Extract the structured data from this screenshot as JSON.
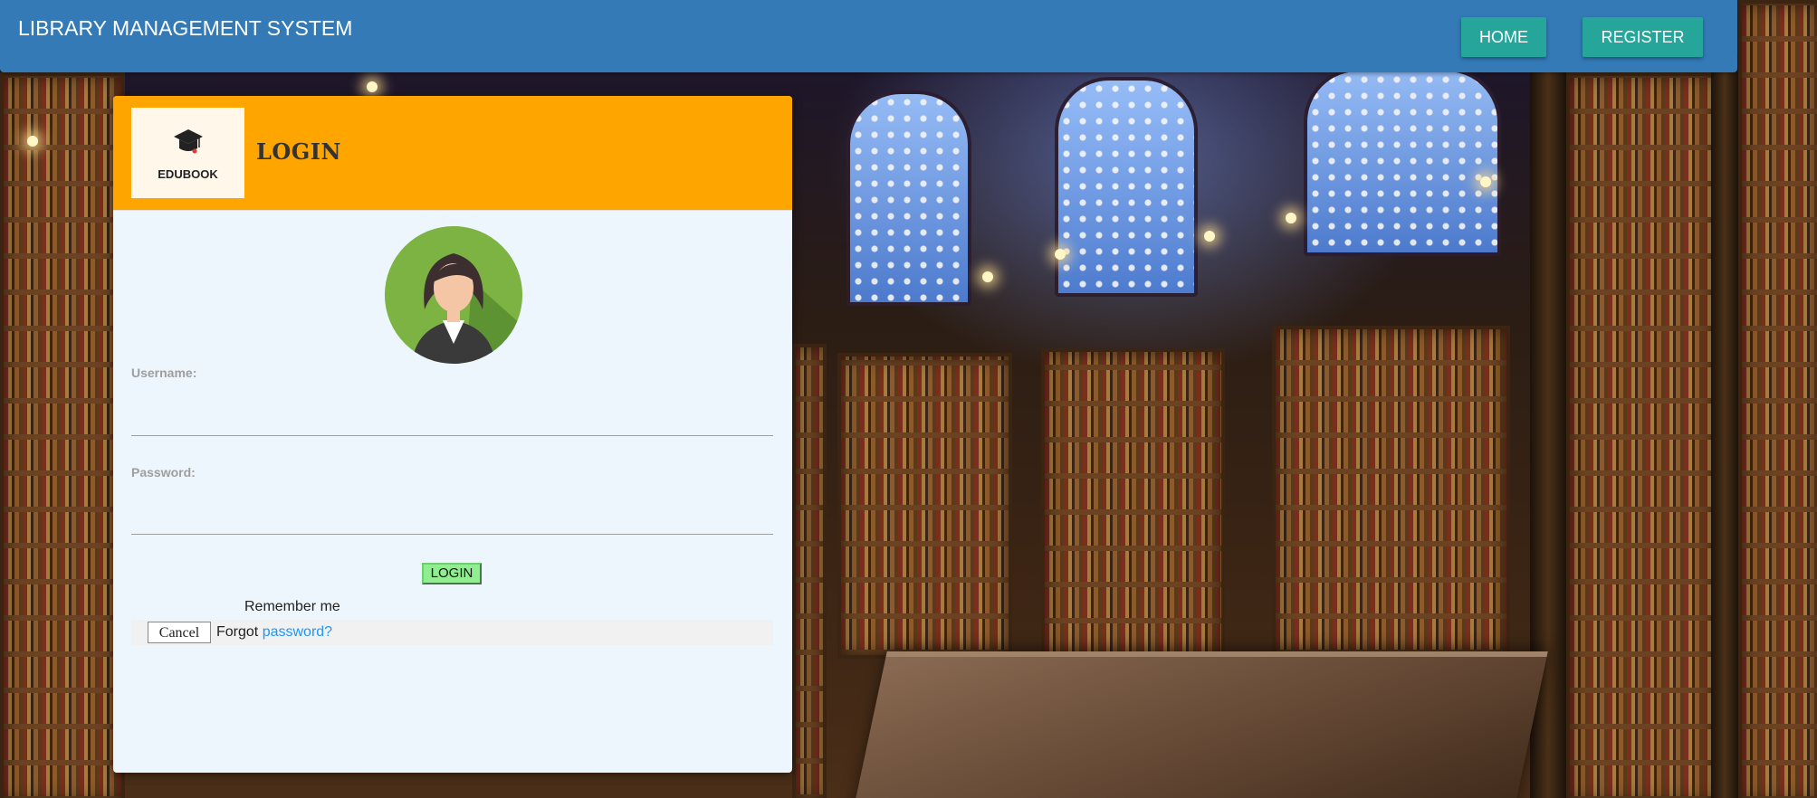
{
  "navbar": {
    "brand": "LIBRARY MANAGEMENT SYSTEM",
    "home_label": "HOME",
    "register_label": "REGISTER",
    "color": "#337ab7",
    "button_color": "#26a69a"
  },
  "login_card": {
    "logo_text": "EDUBOOK",
    "logo_icon": "graduation-cap-icon",
    "title": "LOGIN",
    "header_color": "#ffa500",
    "avatar": "user-avatar-icon",
    "username_label": "Username:",
    "username_value": "",
    "password_label": "Password:",
    "password_value": "",
    "login_button": "LOGIN",
    "remember_label": "Remember me",
    "cancel_button": "Cancel",
    "forgot_text": "Forgot",
    "forgot_link": "password?"
  },
  "background": "library-interior-image"
}
